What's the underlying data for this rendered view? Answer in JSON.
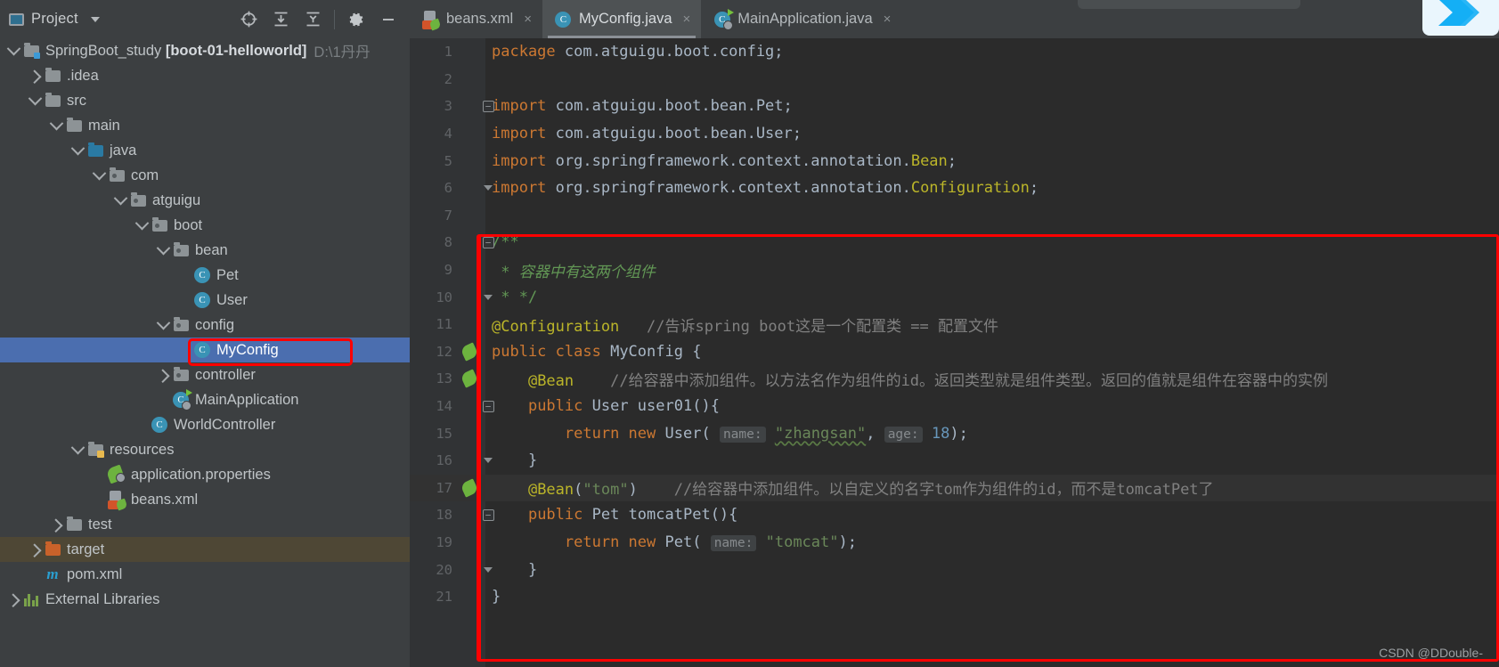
{
  "project_panel": {
    "title": "Project",
    "toolbar_icons": [
      "locate-icon",
      "expand-all-icon",
      "collapse-all-icon",
      "settings-gear-icon",
      "minimize-icon"
    ],
    "tree": [
      {
        "depth": 0,
        "twisty": "down",
        "icon": "module-folder-icon",
        "label": "SpringBoot_study",
        "bold": "[boot-01-helloworld]",
        "path": "D:\\1丹丹",
        "state": "normal"
      },
      {
        "depth": 1,
        "twisty": "right",
        "icon": "folder-icon",
        "label": ".idea",
        "state": "normal"
      },
      {
        "depth": 1,
        "twisty": "down",
        "icon": "folder-icon",
        "label": "src",
        "state": "normal"
      },
      {
        "depth": 2,
        "twisty": "down",
        "icon": "folder-icon",
        "label": "main",
        "state": "normal"
      },
      {
        "depth": 3,
        "twisty": "down",
        "icon": "source-folder-icon",
        "label": "java",
        "state": "normal"
      },
      {
        "depth": 4,
        "twisty": "down",
        "icon": "package-icon",
        "label": "com",
        "state": "normal"
      },
      {
        "depth": 5,
        "twisty": "down",
        "icon": "package-icon",
        "label": "atguigu",
        "state": "normal"
      },
      {
        "depth": 6,
        "twisty": "down",
        "icon": "package-icon",
        "label": "boot",
        "state": "normal"
      },
      {
        "depth": 7,
        "twisty": "down",
        "icon": "package-icon",
        "label": "bean",
        "state": "normal"
      },
      {
        "depth": 8,
        "twisty": "none",
        "icon": "java-class-icon",
        "label": "Pet",
        "state": "normal"
      },
      {
        "depth": 8,
        "twisty": "none",
        "icon": "java-class-icon",
        "label": "User",
        "state": "normal"
      },
      {
        "depth": 7,
        "twisty": "down",
        "icon": "package-icon",
        "label": "config",
        "state": "normal"
      },
      {
        "depth": 8,
        "twisty": "none",
        "icon": "java-class-icon",
        "label": "MyConfig",
        "state": "selected"
      },
      {
        "depth": 7,
        "twisty": "right",
        "icon": "package-icon",
        "label": "controller",
        "state": "normal"
      },
      {
        "depth": 7,
        "twisty": "none",
        "icon": "spring-boot-app-icon",
        "label": "MainApplication",
        "state": "normal"
      },
      {
        "depth": 6,
        "twisty": "none",
        "icon": "java-class-icon",
        "label": "WorldController",
        "state": "normal"
      },
      {
        "depth": 3,
        "twisty": "down",
        "icon": "resources-folder-icon",
        "label": "resources",
        "state": "normal"
      },
      {
        "depth": 4,
        "twisty": "none",
        "icon": "spring-properties-icon",
        "label": "application.properties",
        "state": "normal"
      },
      {
        "depth": 4,
        "twisty": "none",
        "icon": "spring-xml-icon",
        "label": "beans.xml",
        "state": "normal"
      },
      {
        "depth": 2,
        "twisty": "right",
        "icon": "folder-icon",
        "label": "test",
        "state": "normal"
      },
      {
        "depth": 1,
        "twisty": "right",
        "icon": "excluded-folder-icon",
        "label": "target",
        "state": "excluded"
      },
      {
        "depth": 1,
        "twisty": "none",
        "icon": "maven-icon",
        "label": "pom.xml",
        "state": "normal"
      },
      {
        "depth": 0,
        "twisty": "right",
        "icon": "libraries-icon",
        "label": "External Libraries",
        "state": "normal"
      }
    ]
  },
  "editor": {
    "tabs": [
      {
        "label": "beans.xml",
        "icon": "spring-xml-icon",
        "active": false,
        "close": "×"
      },
      {
        "label": "MyConfig.java",
        "icon": "java-class-icon",
        "active": true,
        "close": "×"
      },
      {
        "label": "MainApplication.java",
        "icon": "spring-boot-app-icon",
        "active": false,
        "close": "×"
      }
    ],
    "lines": [
      {
        "n": "1",
        "gutter": "",
        "fold": "",
        "caret": false,
        "tokens": [
          {
            "t": "package ",
            "c": "k"
          },
          {
            "t": "com.atguigu.boot.config;",
            "c": "id"
          }
        ]
      },
      {
        "n": "2",
        "gutter": "",
        "fold": "",
        "caret": false,
        "tokens": []
      },
      {
        "n": "3",
        "gutter": "",
        "fold": "minus",
        "caret": false,
        "tokens": [
          {
            "t": "import ",
            "c": "k"
          },
          {
            "t": "com.atguigu.boot.bean.Pet;",
            "c": "id"
          }
        ]
      },
      {
        "n": "4",
        "gutter": "",
        "fold": "",
        "caret": false,
        "tokens": [
          {
            "t": "import ",
            "c": "k"
          },
          {
            "t": "com.atguigu.boot.bean.User;",
            "c": "id"
          }
        ]
      },
      {
        "n": "5",
        "gutter": "",
        "fold": "",
        "caret": false,
        "tokens": [
          {
            "t": "import ",
            "c": "k"
          },
          {
            "t": "org.springframework.context.annotation.",
            "c": "id"
          },
          {
            "t": "Bean",
            "c": "ann"
          },
          {
            "t": ";",
            "c": "id"
          }
        ]
      },
      {
        "n": "6",
        "gutter": "",
        "fold": "end",
        "caret": false,
        "tokens": [
          {
            "t": "import ",
            "c": "k"
          },
          {
            "t": "org.springframework.context.annotation.",
            "c": "id"
          },
          {
            "t": "Configuration",
            "c": "ann"
          },
          {
            "t": ";",
            "c": "id"
          }
        ]
      },
      {
        "n": "7",
        "gutter": "",
        "fold": "",
        "caret": false,
        "tokens": []
      },
      {
        "n": "8",
        "gutter": "",
        "fold": "minus",
        "caret": false,
        "tokens": [
          {
            "t": "/**",
            "c": "doc-tag"
          }
        ]
      },
      {
        "n": "9",
        "gutter": "",
        "fold": "",
        "caret": false,
        "tokens": [
          {
            "t": " * ",
            "c": "doc-tag"
          },
          {
            "t": "容器中有这两个组件",
            "c": "doc"
          }
        ]
      },
      {
        "n": "10",
        "gutter": "",
        "fold": "end",
        "caret": false,
        "tokens": [
          {
            "t": " * */",
            "c": "doc-tag"
          }
        ]
      },
      {
        "n": "11",
        "gutter": "",
        "fold": "",
        "caret": false,
        "tokens": [
          {
            "t": "@Configuration",
            "c": "ann"
          },
          {
            "t": "   ",
            "c": "id"
          },
          {
            "t": "//告诉spring boot这是一个配置类 == 配置文件",
            "c": "cmt"
          }
        ]
      },
      {
        "n": "12",
        "gutter": "spring-bean-icon",
        "fold": "",
        "caret": false,
        "tokens": [
          {
            "t": "public ",
            "c": "k"
          },
          {
            "t": "class ",
            "c": "k"
          },
          {
            "t": "MyConfig ",
            "c": "id"
          },
          {
            "t": "{",
            "c": "id"
          }
        ]
      },
      {
        "n": "13",
        "gutter": "spring-bean-nav-icon",
        "fold": "",
        "caret": false,
        "tokens": [
          {
            "t": "    ",
            "c": "id"
          },
          {
            "t": "@Bean",
            "c": "ann"
          },
          {
            "t": "    ",
            "c": "id"
          },
          {
            "t": "//给容器中添加组件。以方法名作为组件的id。返回类型就是组件类型。返回的值就是组件在容器中的实例",
            "c": "cmt"
          }
        ]
      },
      {
        "n": "14",
        "gutter": "",
        "fold": "minus",
        "caret": false,
        "tokens": [
          {
            "t": "    ",
            "c": "id"
          },
          {
            "t": "public ",
            "c": "k"
          },
          {
            "t": "User ",
            "c": "id"
          },
          {
            "t": "user01",
            "c": "id"
          },
          {
            "t": "(){",
            "c": "id"
          }
        ]
      },
      {
        "n": "15",
        "gutter": "",
        "fold": "",
        "caret": false,
        "tokens": [
          {
            "t": "        ",
            "c": "id"
          },
          {
            "t": "return ",
            "c": "k"
          },
          {
            "t": "new ",
            "c": "k"
          },
          {
            "t": "User",
            "c": "id"
          },
          {
            "t": "( ",
            "c": "id"
          },
          {
            "t": "name:",
            "c": "hint"
          },
          {
            "t": " ",
            "c": "id"
          },
          {
            "t": "\"zhangsan\"",
            "c": "str-squig"
          },
          {
            "t": ", ",
            "c": "id"
          },
          {
            "t": "age:",
            "c": "hint"
          },
          {
            "t": " ",
            "c": "id"
          },
          {
            "t": "18",
            "c": "num"
          },
          {
            "t": ");",
            "c": "id"
          }
        ]
      },
      {
        "n": "16",
        "gutter": "",
        "fold": "end",
        "caret": false,
        "tokens": [
          {
            "t": "    }",
            "c": "id"
          }
        ]
      },
      {
        "n": "17",
        "gutter": "spring-bean-nav-icon",
        "fold": "",
        "caret": true,
        "tokens": [
          {
            "t": "    ",
            "c": "id"
          },
          {
            "t": "@Bean",
            "c": "ann"
          },
          {
            "t": "(",
            "c": "id"
          },
          {
            "t": "\"tom\"",
            "c": "str"
          },
          {
            "t": ")",
            "c": "id"
          },
          {
            "t": "    ",
            "c": "id"
          },
          {
            "t": "//给容器中添加组件。以自定义的名字tom作为组件的id，而不是tomcatPet了",
            "c": "cmt"
          }
        ]
      },
      {
        "n": "18",
        "gutter": "",
        "fold": "minus",
        "caret": false,
        "tokens": [
          {
            "t": "    ",
            "c": "id"
          },
          {
            "t": "public ",
            "c": "k"
          },
          {
            "t": "Pet ",
            "c": "id"
          },
          {
            "t": "tomcatPet",
            "c": "id"
          },
          {
            "t": "(){",
            "c": "id"
          }
        ]
      },
      {
        "n": "19",
        "gutter": "",
        "fold": "",
        "caret": false,
        "tokens": [
          {
            "t": "        ",
            "c": "id"
          },
          {
            "t": "return ",
            "c": "k"
          },
          {
            "t": "new ",
            "c": "k"
          },
          {
            "t": "Pet",
            "c": "id"
          },
          {
            "t": "( ",
            "c": "id"
          },
          {
            "t": "name:",
            "c": "hint"
          },
          {
            "t": " ",
            "c": "id"
          },
          {
            "t": "\"tomcat\"",
            "c": "str"
          },
          {
            "t": ");",
            "c": "id"
          }
        ]
      },
      {
        "n": "20",
        "gutter": "",
        "fold": "end",
        "caret": false,
        "tokens": [
          {
            "t": "    }",
            "c": "id"
          }
        ]
      },
      {
        "n": "21",
        "gutter": "",
        "fold": "",
        "caret": false,
        "tokens": [
          {
            "t": "}",
            "c": "id"
          }
        ]
      }
    ]
  },
  "annotations": {
    "code_rect_color": "#fe0000",
    "tree_rect_color": "#fe0000",
    "watermark": "CSDN @DDouble-"
  },
  "colors": {
    "panel_bg": "#3c3f41",
    "editor_bg": "#2b2b2b",
    "gutter_bg": "#313335",
    "selection_blue": "#4b6eaf",
    "excluded_brown": "#4e4735",
    "keyword": "#cc7832",
    "annotation": "#bbb529",
    "string": "#6a8759",
    "number": "#6897bb",
    "comment": "#808080",
    "javadoc": "#629755",
    "identifier": "#a9b7c6"
  }
}
